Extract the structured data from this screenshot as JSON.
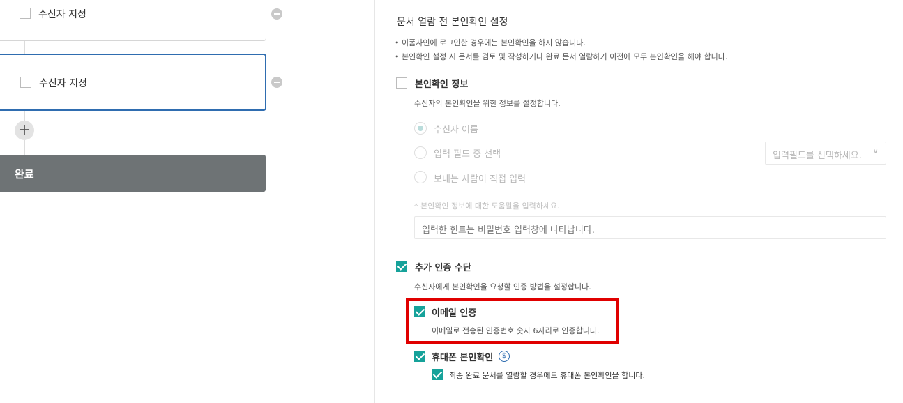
{
  "left": {
    "cards": [
      {
        "label": "수신자 지정"
      },
      {
        "label": "수신자 지정"
      }
    ],
    "add_label": "+",
    "done_label": "완료"
  },
  "right": {
    "title": "문서 열람 전 본인확인 설정",
    "notes": [
      "이폼사인에 로그인한 경우에는 본인확인을 하지 않습니다.",
      "본인확인 설정 시 문서를 검토 및 작성하거나 완료 문서 열람하기 이전에 모두 본인확인을 해야 합니다."
    ],
    "identity": {
      "label": "본인확인 정보",
      "checked": false,
      "desc": "수신자의 본인확인을 위한 정보를 설정합니다.",
      "options": [
        {
          "label": "수신자 이름",
          "selected": true
        },
        {
          "label": "입력 필드 중 선택",
          "selected": false
        },
        {
          "label": "보내는 사람이 직접 입력",
          "selected": false
        }
      ],
      "field_select": {
        "value": "입력필드를 선택하세요.",
        "chevron": "∨"
      },
      "hint_label": "* 본인확인 정보에 대한 도움말을 입력하세요.",
      "hint_placeholder": "입력한 힌트는 비밀번호 입력창에 나타납니다."
    },
    "additional": {
      "label": "추가 인증 수단",
      "checked": true,
      "desc": "수신자에게 본인확인을 요청할 인증 방법을 설정합니다.",
      "email": {
        "label": "이메일 인증",
        "checked": true,
        "desc": "이메일로 전송된 인증번호 숫자 6자리로 인증합니다."
      },
      "phone": {
        "label": "휴대폰 본인확인",
        "checked": true,
        "badge": "$",
        "sub_option": {
          "label": "최종 완료 문서를 열람할 경우에도 휴대폰 본인확인을 합니다.",
          "checked": true
        }
      }
    }
  },
  "colors": {
    "accent": "#16a29a",
    "selected_border": "#2f6db0",
    "highlight": "#e00000",
    "done_bg": "#6e7375"
  }
}
